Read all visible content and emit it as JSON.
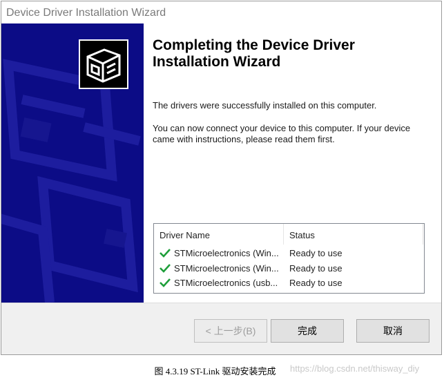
{
  "window": {
    "title": "Device Driver Installation Wizard"
  },
  "main": {
    "heading": "Completing the Device Driver Installation Wizard",
    "success_text": "The drivers were successfully installed on this computer.",
    "instructions_text": "You can now connect your device to this computer. If your device came with instructions, please read them first."
  },
  "driver_table": {
    "columns": [
      "Driver Name",
      "Status"
    ],
    "rows": [
      {
        "name": "STMicroelectronics (Win...",
        "status": "Ready to use"
      },
      {
        "name": "STMicroelectronics (Win...",
        "status": "Ready to use"
      },
      {
        "name": "STMicroelectronics (usb...",
        "status": "Ready to use"
      }
    ]
  },
  "buttons": {
    "back_label": "< 上一步(B)",
    "finish_label": "完成",
    "cancel_label": "取消"
  },
  "caption": {
    "figure_text": "图  4.3.19 ST-Link 驱动安装完成",
    "watermark": "https://blog.csdn.net/thisway_diy"
  },
  "colors": {
    "banner": "#0c0c86",
    "check": "#1e9e3a"
  },
  "icons": {
    "wizard_logo": "hardware-install-icon",
    "row_status": "check-icon"
  }
}
